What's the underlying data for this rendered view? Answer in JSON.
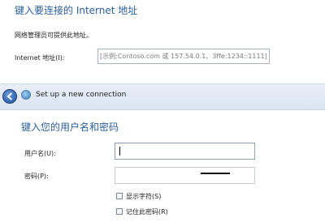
{
  "top": {
    "heading": "键入要连接的 Internet 地址",
    "admin_note": "网络管理员可提供此地址。",
    "address_label": "Internet 地址(I):",
    "address_placeholder": "[示例:Contoso.com 或 157.54.0.1、3ffe:1234::1111]"
  },
  "band": {
    "title": "Set up a new connection",
    "back_icon": "back-arrow-icon",
    "app_icon": "network-globe-icon"
  },
  "form": {
    "heading": "键入您的用户名和密码",
    "username_label": "用户名(U):",
    "username_value": "",
    "password_label": "密码(P):",
    "show_chars_label": "显示字符(S)",
    "remember_label": "记住此密码(R)"
  },
  "colors": {
    "heading": "#2a5f9e",
    "band": "#dde6f2"
  }
}
